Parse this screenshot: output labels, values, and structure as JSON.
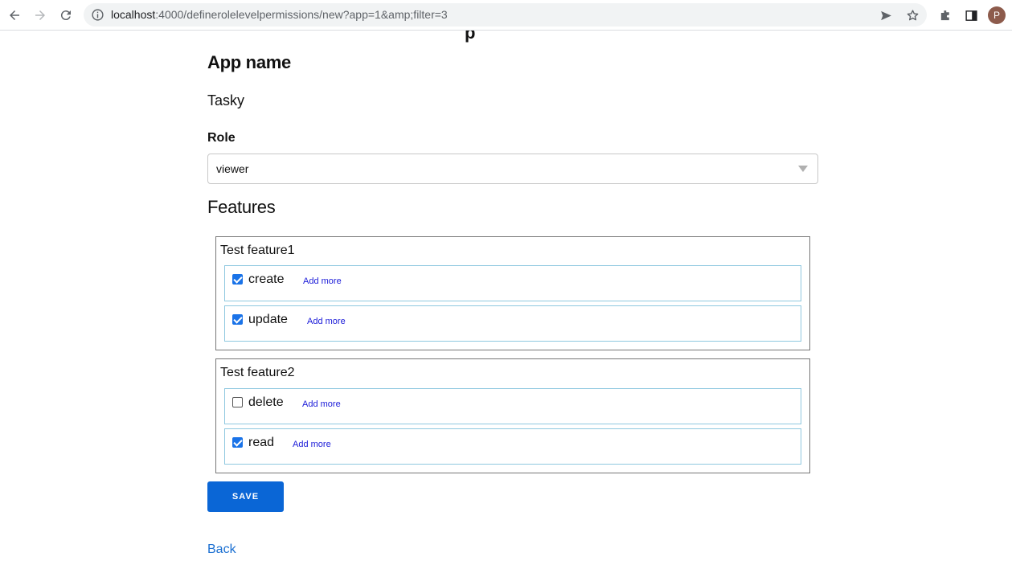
{
  "browser": {
    "url_host": "localhost",
    "url_rest": ":4000/definerolelevelpermissions/new?app=1&amp;filter=3",
    "profile_initial": "P"
  },
  "page": {
    "app_heading": "App name",
    "app_value": "Tasky",
    "role_label": "Role",
    "role_selected": "viewer",
    "features_heading": "Features",
    "features": [
      {
        "name": "Test feature1",
        "permissions": [
          {
            "name": "create",
            "checked": true,
            "add_more": "Add more"
          },
          {
            "name": "update",
            "checked": true,
            "add_more": "Add more"
          }
        ]
      },
      {
        "name": "Test feature2",
        "permissions": [
          {
            "name": "delete",
            "checked": false,
            "add_more": "Add more"
          },
          {
            "name": "read",
            "checked": true,
            "add_more": "Add more"
          }
        ]
      }
    ],
    "save_label": "SAVE",
    "back_label": "Back"
  },
  "colors": {
    "accent": "#0a66d6",
    "link": "#1a6fd1",
    "row_border": "#8fc8e0"
  }
}
